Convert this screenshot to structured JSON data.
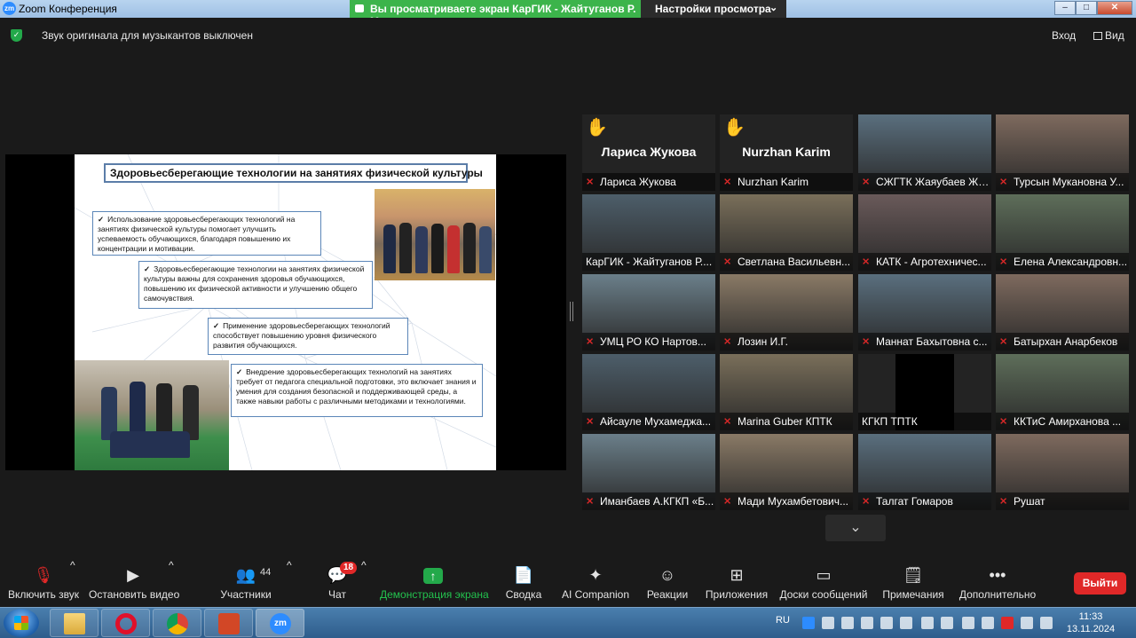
{
  "window": {
    "app_icon": "zm",
    "title": "Zoom Конференция",
    "share_banner": "Вы просматриваете экран КарГИК - Жайтуганов Р. М.",
    "view_options": "Настройки просмотра"
  },
  "infobar": {
    "audio_message": "Звук оригинала для музыкантов выключен",
    "exit_fullscreen": "Вход",
    "view": "Вид"
  },
  "slide": {
    "title": "Здоровьесберегающие технологии на занятиях физической культуры",
    "bullets": [
      "Использование здоровьесберегающих технологий на занятиях физической культуры помогает улучшить успеваемость обучающихся, благодаря повышению их концентрации и мотивации.",
      "Здоровьесберегающие технологии на занятиях физической культуры важны для сохранения здоровья обучающихся, повышению их физической активности и улучшению общего самочувствия.",
      "Применение здоровьесберегающих технологий способствует повышению уровня физического развития обучающихся.",
      "Внедрение здоровьесберегающих технологий на занятиях требует от педагога специальной подготовки, это включает знания и умения для создания безопасной и поддерживающей среды, а также навыки работы с различными методиками и технологиями."
    ]
  },
  "participants": [
    {
      "name": "Лариса Жукова",
      "big_name": "Лариса Жукова",
      "hand": true,
      "muted": true
    },
    {
      "name": "Nurzhan Karim",
      "big_name": "Nurzhan Karim",
      "hand": true,
      "muted": true
    },
    {
      "name": "СЖГТК Жаяубаев Жа...",
      "muted": true
    },
    {
      "name": "Турсын Мукановна У...",
      "muted": true
    },
    {
      "name": "КарГИК - Жайтуганов Р....",
      "muted": false,
      "active": true
    },
    {
      "name": "Светлана Васильевн...",
      "muted": true
    },
    {
      "name": "КАТК - Агротехничес...",
      "muted": true
    },
    {
      "name": "Елена Александровн...",
      "muted": true
    },
    {
      "name": "УМЦ РО КО Нартов...",
      "muted": true
    },
    {
      "name": "Лозин И.Г.",
      "muted": true
    },
    {
      "name": "Маннат Бахытовна с...",
      "muted": true
    },
    {
      "name": "Батырхан Анарбеков",
      "muted": true
    },
    {
      "name": "Айсауле Мухамеджа...",
      "muted": true
    },
    {
      "name": "Marina Guber КПТК",
      "muted": true
    },
    {
      "name": "КГКП ТПТК",
      "muted": false
    },
    {
      "name": "ККТиС Амирханова ...",
      "muted": true
    },
    {
      "name": "Иманбаев А.КГКП «Б...",
      "muted": true
    },
    {
      "name": "Мади Мухамбетович...",
      "muted": true
    },
    {
      "name": "Талгат Гомаров",
      "muted": true
    },
    {
      "name": "Рушат",
      "muted": true
    }
  ],
  "toolbar": {
    "unmute": "Включить звук",
    "stop_video": "Остановить видео",
    "participants": "Участники",
    "participants_count": "44",
    "chat": "Чат",
    "chat_badge": "18",
    "share": "Демонстрация экрана",
    "summary": "Сводка",
    "ai": "AI Companion",
    "reactions": "Реакции",
    "apps": "Приложения",
    "whiteboards": "Доски сообщений",
    "notes": "Примечания",
    "more": "Дополнительно",
    "leave": "Выйти"
  },
  "taskbar": {
    "lang": "RU",
    "time": "11:33",
    "date": "13.11.2024",
    "zoom_app": "zm"
  }
}
